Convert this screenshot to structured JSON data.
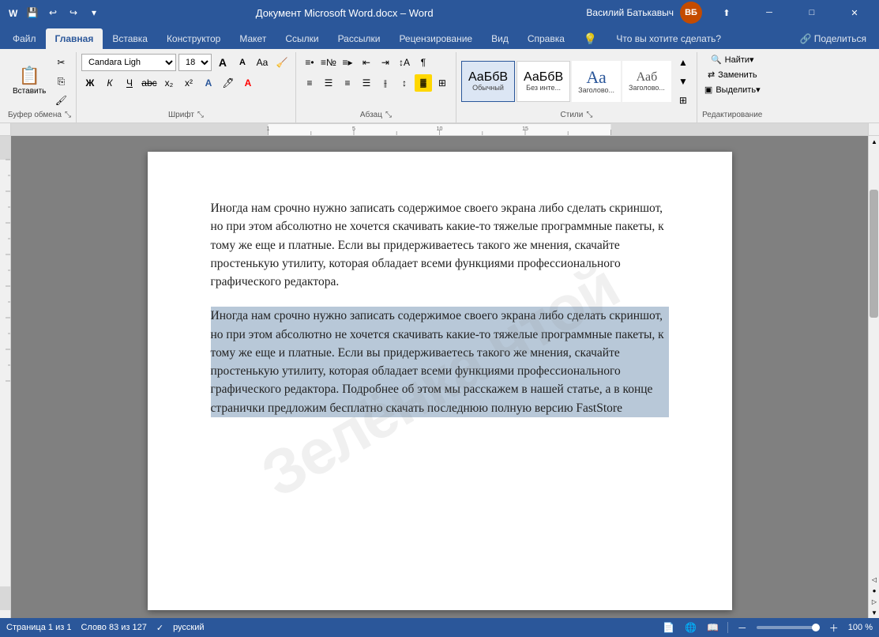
{
  "titlebar": {
    "document_name": "Документ Microsoft Word.docx  –  Word",
    "app_name": "Word",
    "user_name": "Василий Батькавыч",
    "user_initials": "ВБ",
    "save_label": "💾",
    "undo_label": "↩",
    "redo_label": "↪",
    "customize_label": "▾"
  },
  "ribbon_tabs": [
    {
      "id": "file",
      "label": "Файл"
    },
    {
      "id": "home",
      "label": "Главная",
      "active": true
    },
    {
      "id": "insert",
      "label": "Вставка"
    },
    {
      "id": "design",
      "label": "Конструктор"
    },
    {
      "id": "layout",
      "label": "Макет"
    },
    {
      "id": "references",
      "label": "Ссылки"
    },
    {
      "id": "mailings",
      "label": "Рассылки"
    },
    {
      "id": "review",
      "label": "Рецензирование"
    },
    {
      "id": "view",
      "label": "Вид"
    },
    {
      "id": "help",
      "label": "Справка"
    },
    {
      "id": "lightbulb",
      "label": "💡"
    },
    {
      "id": "search",
      "label": "Что вы хотите сделать?"
    }
  ],
  "ribbon": {
    "clipboard_group": "Буфер обмена",
    "font_group": "Шрифт",
    "paragraph_group": "Абзац",
    "styles_group": "Стили",
    "editing_group": "Редактирование",
    "paste_label": "Вставить",
    "font_name": "Candara Ligh",
    "font_size": "18",
    "bold": "Ж",
    "italic": "К",
    "underline": "Ч",
    "strikethrough": "abc",
    "subscript": "x₂",
    "superscript": "x²",
    "find_label": "Найти",
    "replace_label": "Заменить",
    "select_label": "Выделить",
    "share_label": "Поделиться"
  },
  "styles": [
    {
      "id": "normal",
      "preview": "АаБбВ",
      "label": "Обычный",
      "active": true
    },
    {
      "id": "no_spacing",
      "preview": "АаБбВ",
      "label": "Без инте..."
    },
    {
      "id": "heading1",
      "preview": "Аа",
      "label": "Заголово..."
    },
    {
      "id": "heading2",
      "preview": "Ааб",
      "label": "Заголово..."
    }
  ],
  "document": {
    "paragraph1": "Иногда нам срочно нужно записать содержимое своего экрана либо сделать скриншот, но при этом абсолютно не хочется скачивать какие-то тяжелые программные пакеты, к тому же еще и платные. Если вы придерживаетесь такого же мнения, скачайте простенькую утилиту, которая обладает всеми функциями профессионального графического редактора.",
    "paragraph2": "Иногда нам срочно нужно записать содержимое своего экрана либо сделать скриншот, но при этом абсолютно не хочется скачивать какие-то тяжелые программные пакеты, к тому же еще и платные. Если вы придерживаетесь такого же мнения, скачайте простенькую утилиту, которая обладает всеми функциями профессионального графического редактора. Подробнее об этом мы расскажем в нашей статье, а в конце странички предложим бесплатно скачать последнюю полную версию FastStore"
  },
  "statusbar": {
    "page_info": "Страница 1 из 1",
    "word_count": "Слово 83 из 127",
    "language": "русский",
    "zoom_pct": "100 %"
  },
  "watermark": "Зелёнка чтой"
}
